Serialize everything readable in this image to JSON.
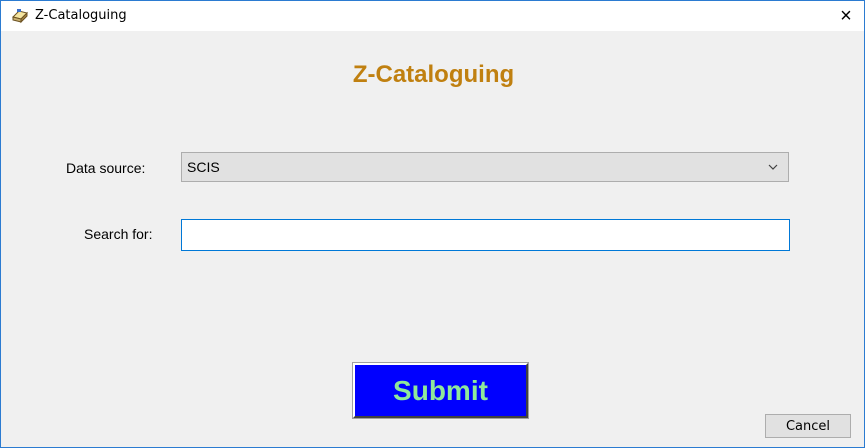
{
  "window": {
    "title": "Z-Cataloguing",
    "icon": "app-icon",
    "close_label": "×"
  },
  "main": {
    "heading": "Z-Cataloguing",
    "heading_color": "#c08010"
  },
  "form": {
    "data_source_label": "Data source:",
    "data_source_value": "SCIS",
    "search_label": "Search for:",
    "search_value": "",
    "search_placeholder": ""
  },
  "buttons": {
    "submit_label": "Submit",
    "submit_bg": "#0000ff",
    "submit_fg": "#8fe89a",
    "cancel_label": "Cancel"
  }
}
